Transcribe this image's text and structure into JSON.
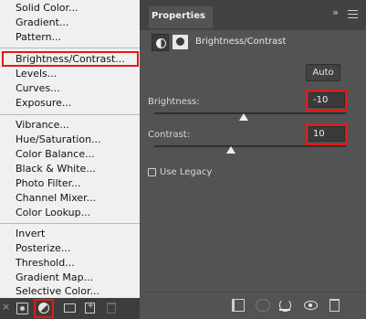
{
  "menu": {
    "groups": [
      [
        "Solid Color...",
        "Gradient...",
        "Pattern..."
      ],
      [
        "Brightness/Contrast...",
        "Levels...",
        "Curves...",
        "Exposure..."
      ],
      [
        "Vibrance...",
        "Hue/Saturation...",
        "Color Balance...",
        "Black & White...",
        "Photo Filter...",
        "Channel Mixer...",
        "Color Lookup..."
      ],
      [
        "Invert",
        "Posterize...",
        "Threshold...",
        "Gradient Map...",
        "Selective Color..."
      ]
    ],
    "highlighted": "Brightness/Contrast..."
  },
  "layers_bar": {
    "icons": [
      "close-icon",
      "layer-mask-icon",
      "adjustment-layer-icon",
      "group-folder-icon",
      "new-layer-icon",
      "trash-icon"
    ],
    "highlighted_icon": "adjustment-layer-icon"
  },
  "properties": {
    "tab_label": "Properties",
    "collapse_glyph": "»",
    "title": "Brightness/Contrast",
    "auto_label": "Auto",
    "brightness_label": "Brightness:",
    "brightness_value": "-10",
    "brightness_slider": {
      "min": -150,
      "max": 150,
      "value": -10
    },
    "contrast_label": "Contrast:",
    "contrast_value": "10",
    "contrast_slider": {
      "min": -50,
      "max": 100,
      "value": 10
    },
    "legacy_label": "Use Legacy",
    "legacy_checked": false
  },
  "colors": {
    "highlight_red": "#e01a1a",
    "panel_bg": "#535353",
    "menu_bg": "#f0f0f0"
  }
}
